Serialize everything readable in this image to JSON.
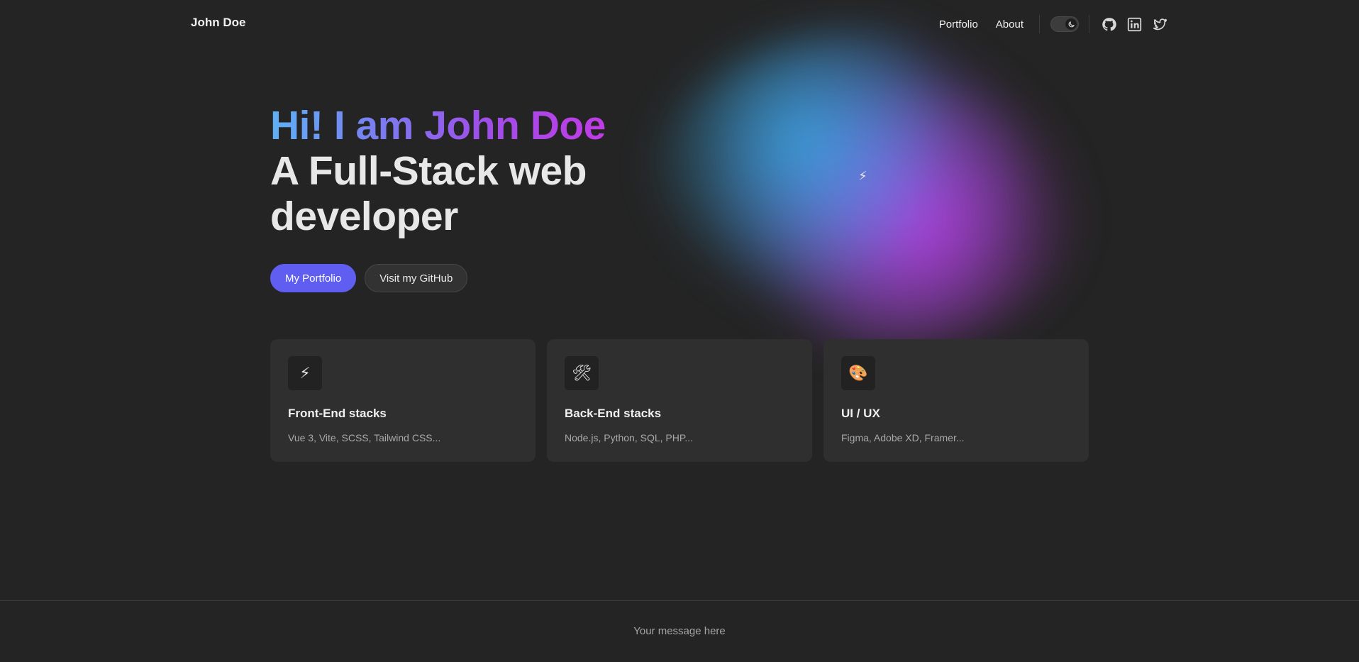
{
  "header": {
    "brand": "John Doe",
    "nav": [
      {
        "label": "Portfolio"
      },
      {
        "label": "About"
      }
    ],
    "theme_toggle": {
      "icon": "moon-icon",
      "state": "dark"
    },
    "social": [
      {
        "icon": "github-icon"
      },
      {
        "icon": "linkedin-icon"
      },
      {
        "icon": "twitter-icon"
      }
    ]
  },
  "glow": {
    "icon": "lightning-icon",
    "glyph": "⚡",
    "colors": [
      "#38aae6",
      "#786ef0",
      "#be3ce6"
    ]
  },
  "hero": {
    "greeting": "Hi! I am John Doe",
    "subtitle": "A Full-Stack web developer",
    "primary_button": "My Portfolio",
    "secondary_button": "Visit my GitHub",
    "gradient": [
      "#5eb0f5",
      "#7d79f0",
      "#a04de8",
      "#c13ce6"
    ],
    "accent": "#5f5ef0"
  },
  "cards": [
    {
      "icon": "lightning-icon",
      "glyph": "⚡",
      "title": "Front-End stacks",
      "description": "Vue 3, Vite, SCSS, Tailwind CSS..."
    },
    {
      "icon": "tools-icon",
      "glyph": "🛠",
      "title": "Back-End stacks",
      "description": "Node.js, Python, SQL, PHP..."
    },
    {
      "icon": "palette-icon",
      "glyph": "🎨",
      "title": "UI / UX",
      "description": "Figma, Adobe XD, Framer..."
    }
  ],
  "footer": {
    "message": "Your message here"
  }
}
